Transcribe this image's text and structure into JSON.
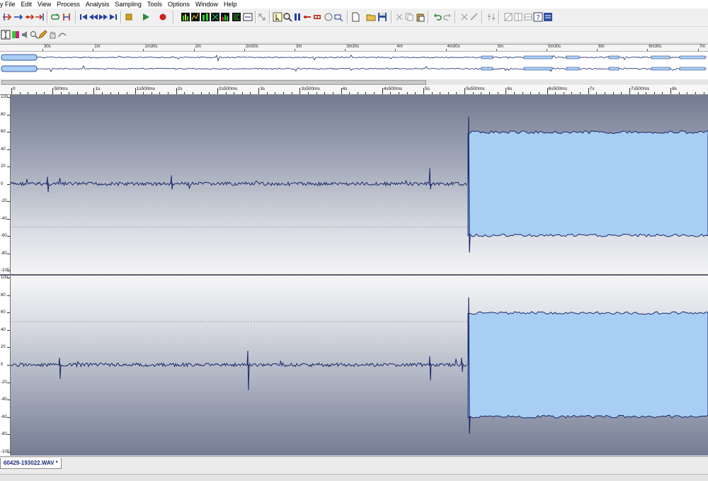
{
  "menu": {
    "items": [
      "y File",
      "Edit",
      "View",
      "Process",
      "Analysis",
      "Sampling",
      "Tools",
      "Options",
      "Window",
      "Help"
    ]
  },
  "overview": {
    "labels": [
      "30s",
      "1m",
      "1m30s",
      "2m",
      "2m30s",
      "3m",
      "3m30s",
      "4m",
      "4m30s",
      "5m",
      "5m30s",
      "6m",
      "6m30s",
      "7m"
    ]
  },
  "ruler": {
    "labels": [
      "0",
      "500ms",
      "1s",
      "1s500ms",
      "2s",
      "2s500ms",
      "3s",
      "3s500ms",
      "4s",
      "4s500ms",
      "5s",
      "5s500ms",
      "6s",
      "6s500ms",
      "7s",
      "7s500ms",
      "8s"
    ]
  },
  "channels": {
    "scale_labels": [
      "100",
      "80",
      "60",
      "40",
      "20",
      "0",
      "-20",
      "-40",
      "-60",
      "-80",
      "-100"
    ]
  },
  "tabbar": {
    "file_tab": "60429-193022.WAV *"
  },
  "colors": {
    "waveform_fill": "#a8cef4",
    "waveform_line": "#1b2a6b",
    "background_top": "#737b91",
    "background_bottom": "#f4f4f6"
  }
}
